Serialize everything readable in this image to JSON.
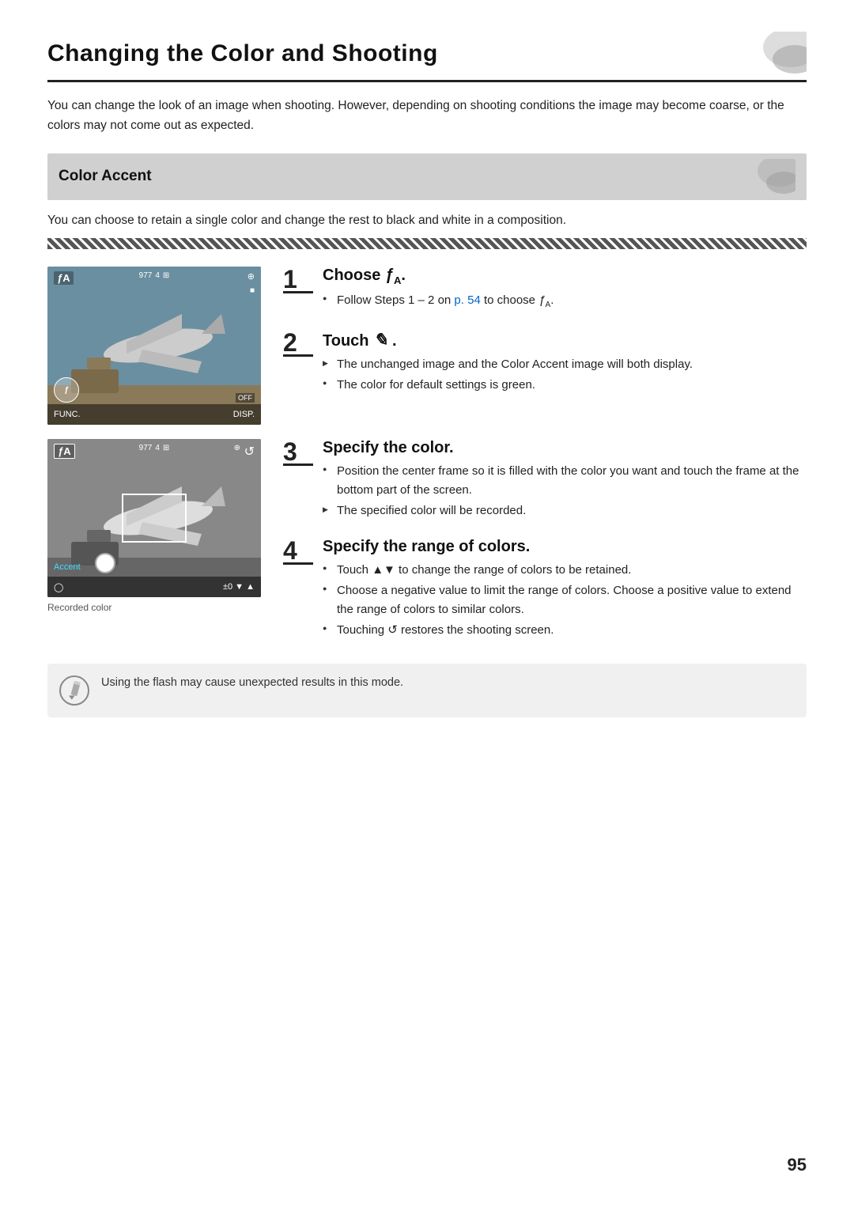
{
  "page": {
    "number": "95"
  },
  "header": {
    "title": "Changing the Color and Shooting"
  },
  "intro": {
    "text": "You can change the look of an image when shooting. However, depending on shooting conditions the image may become coarse, or the colors may not come out as expected."
  },
  "section": {
    "title": "Color Accent",
    "description": "You can choose to retain a single color and change the rest to black and white in a composition."
  },
  "steps": [
    {
      "number": "1",
      "title": "Choose ⁄A.",
      "bullets": [
        {
          "type": "circle",
          "text": "Follow Steps 1–2 on p. 54 to choose ⁄A."
        }
      ]
    },
    {
      "number": "2",
      "title": "Touch ⁄ .",
      "bullets": [
        {
          "type": "triangle",
          "text": "The unchanged image and the Color Accent image will both display."
        },
        {
          "type": "circle",
          "text": "The color for default settings is green."
        }
      ]
    },
    {
      "number": "3",
      "title": "Specify the color.",
      "bullets": [
        {
          "type": "circle",
          "text": "Position the center frame so it is filled with the color you want and touch the frame at the bottom part of the screen."
        },
        {
          "type": "triangle",
          "text": "The specified color will be recorded."
        }
      ]
    },
    {
      "number": "4",
      "title": "Specify the range of colors.",
      "bullets": [
        {
          "type": "circle",
          "text": "Touch ▲▼ to change the range of colors to be retained."
        },
        {
          "type": "circle",
          "text": "Choose a negative value to limit the range of colors. Choose a positive value to extend the range of colors to similar colors."
        },
        {
          "type": "circle",
          "text": "Touching ↺ restores the shooting screen."
        }
      ]
    }
  ],
  "images": {
    "image1": {
      "fa_label": "⁄A",
      "top_right": "⊙",
      "bottom_left": "FUNC.",
      "bottom_right": "DISP."
    },
    "image2": {
      "fa_label": "⁄A",
      "accent_label": "Accent",
      "bottom_left": "○",
      "bottom_controls": "±0 ▼ ▲"
    },
    "recorded_color_label": "Recorded color"
  },
  "note": {
    "text": "Using the flash may cause unexpected results in this mode."
  }
}
